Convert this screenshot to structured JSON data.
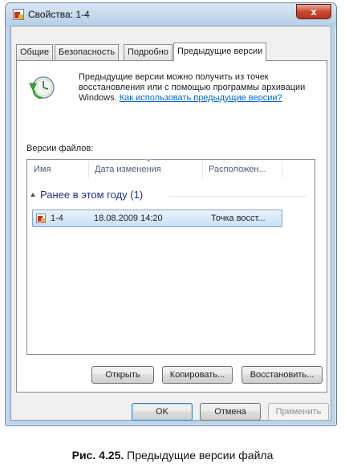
{
  "window": {
    "title": "Свойства: 1-4",
    "close_glyph": "x"
  },
  "tabs": [
    {
      "label": "Общие"
    },
    {
      "label": "Безопасность"
    },
    {
      "label": "Подробно"
    },
    {
      "label": "Предыдущие версии",
      "active": true
    }
  ],
  "intro": {
    "text": "Предыдущие версии можно получить из точек восстановления или с помощью программы архивации Windows.",
    "link": "Как использовать предыдущие версии?"
  },
  "versions": {
    "label": "Версии файлов:",
    "columns": [
      "Имя",
      "Дата изменения",
      "Расположен..."
    ],
    "group": "Ранее в этом году (1)",
    "rows": [
      {
        "name": "1-4",
        "date": "18.08.2009 14:20",
        "location": "Точка восст..."
      }
    ]
  },
  "panel_buttons": {
    "open": "Открыть",
    "copy": "Копировать...",
    "restore": "Восстановить..."
  },
  "dialog_buttons": {
    "ok": "OK",
    "cancel": "Отмена",
    "apply": "Применить"
  },
  "caption": {
    "number": "Рис. 4.25.",
    "text": "Предыдущие версии файла"
  },
  "colors": {
    "link": "#0066cc",
    "group_header": "#1e3287",
    "selection": "#c9def5"
  }
}
